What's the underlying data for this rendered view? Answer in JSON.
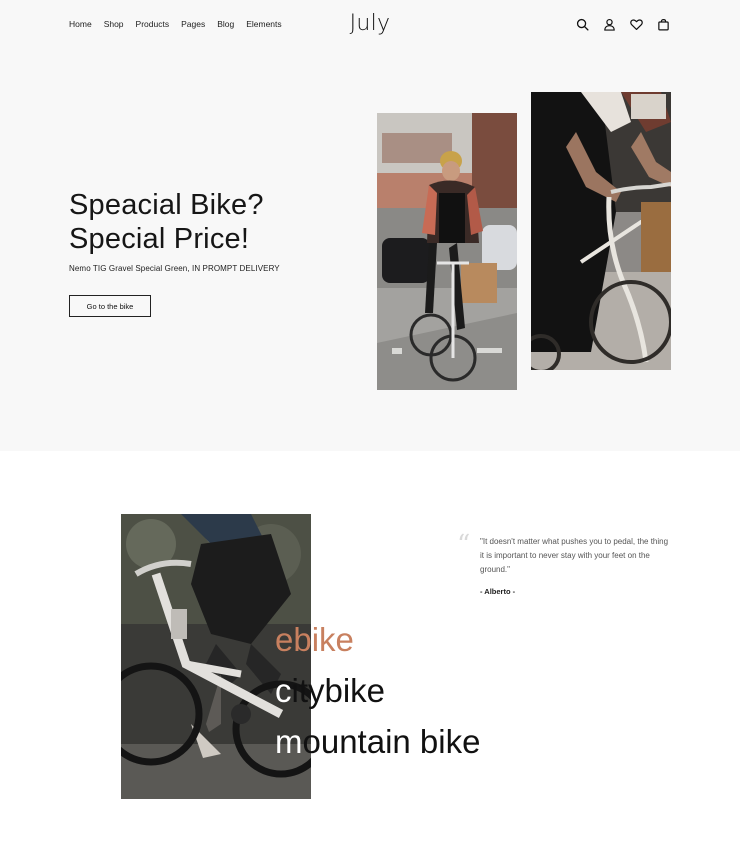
{
  "header": {
    "nav": [
      "Home",
      "Shop",
      "Products",
      "Pages",
      "Blog",
      "Elements"
    ],
    "logo": "July",
    "icons": [
      "search-icon",
      "user-icon",
      "heart-icon",
      "bag-icon"
    ]
  },
  "hero": {
    "title_line1": "Speacial Bike?",
    "title_line2": "Special Price!",
    "subtitle": "Nemo TIG Gravel Special Green, IN PROMPT DELIVERY",
    "cta_label": "Go to the bike"
  },
  "categories": {
    "items": [
      "ebike",
      "citybike",
      "mountain bike"
    ],
    "accent_color": "#c8805f"
  },
  "testimonial": {
    "quote": "\"It doesn't matter what pushes you to pedal, the thing it is important to never stay with your feet on the ground.\"",
    "author": "- Alberto -"
  }
}
